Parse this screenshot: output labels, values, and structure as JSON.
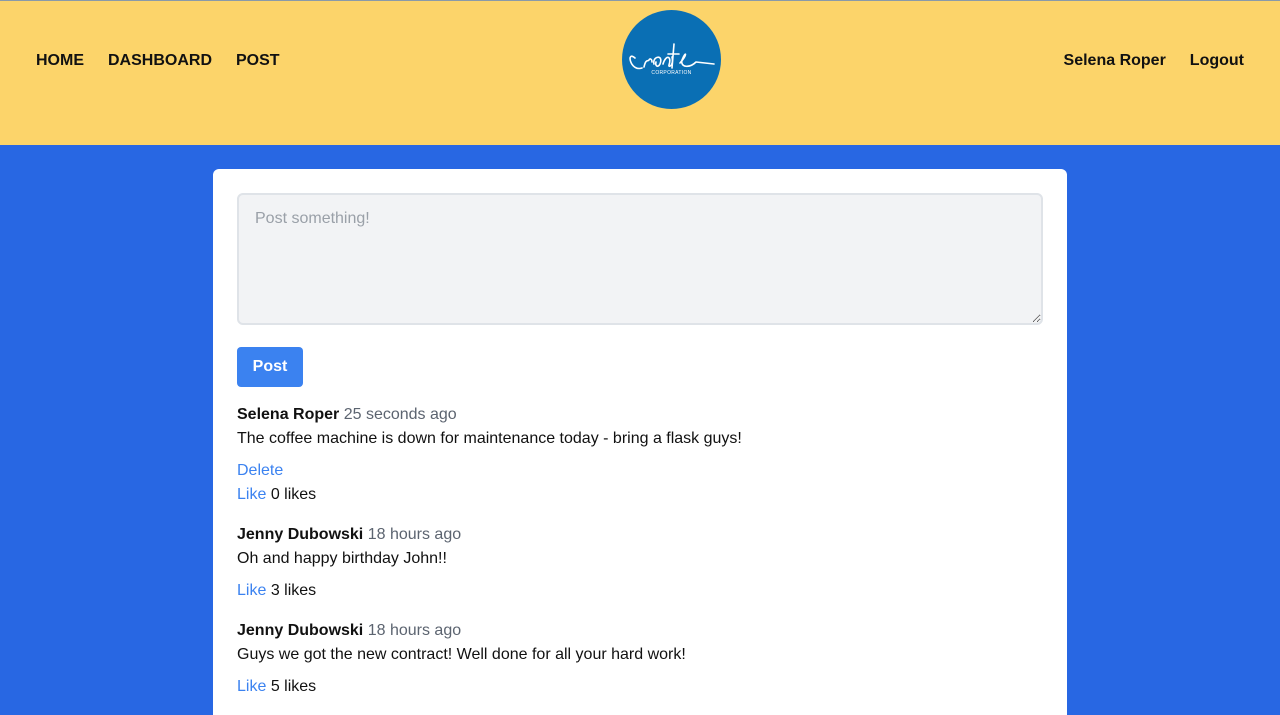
{
  "nav": {
    "left": [
      "HOME",
      "DASHBOARD",
      "POST"
    ],
    "user": "Selena Roper",
    "logout": "Logout"
  },
  "logo": {
    "text": "Create",
    "subtext": "CORPORATION"
  },
  "composer": {
    "placeholder": "Post something!",
    "value": ""
  },
  "post_button": "Post",
  "posts": [
    {
      "author": "Selena Roper",
      "time": "25 seconds ago",
      "body": "The coffee machine is down for maintenance today - bring a flask guys!",
      "delete_label": "Delete",
      "like_label": "Like",
      "likes": "0 likes"
    },
    {
      "author": "Jenny Dubowski",
      "time": "18 hours ago",
      "body": "Oh and happy birthday John!!",
      "like_label": "Like",
      "likes": "3 likes"
    },
    {
      "author": "Jenny Dubowski",
      "time": "18 hours ago",
      "body": "Guys we got the new contract! Well done for all your hard work!",
      "like_label": "Like",
      "likes": "5 likes"
    }
  ],
  "colors": {
    "header_bg": "#fcd46a",
    "page_bg": "#2867e3",
    "accent": "#3b82f0",
    "logo_bg": "#0a6fb4"
  }
}
